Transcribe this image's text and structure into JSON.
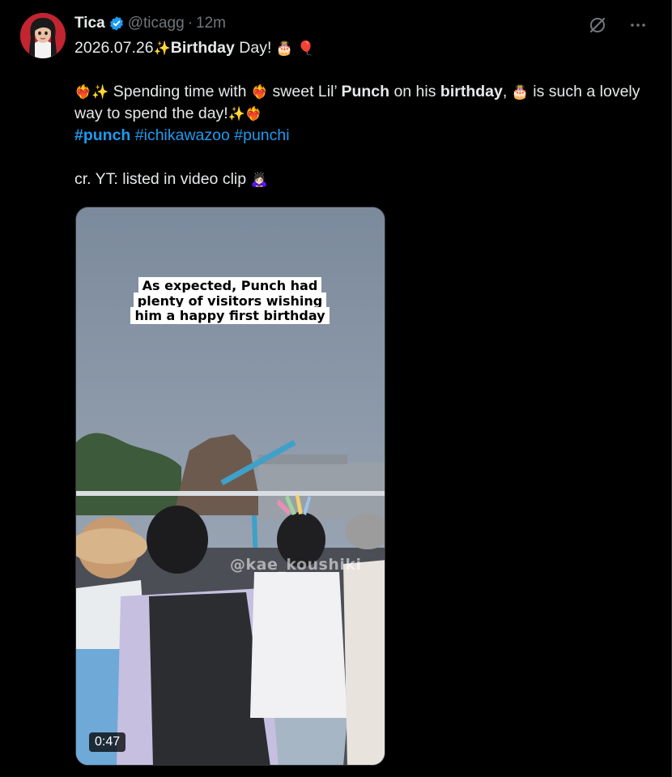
{
  "author": {
    "name": "Tica",
    "handle": "@ticagg",
    "separator": "·",
    "time": "12m"
  },
  "post": {
    "line1_date": "2026.07.26",
    "line1_bold": "Birthday",
    "line1_rest": " Day! ",
    "line2_a": " Spending time with ",
    "line2_b": " sweet Lil’ ",
    "line2_punch": "Punch",
    "line2_c": " on his ",
    "line2_birthday": "birthday",
    "line2_d": ", ",
    "line2_e": " is such a lovely way to spend the day!",
    "hashtags": [
      "#punch",
      "#ichikawazoo",
      "#punchi"
    ],
    "credit": "cr. YT: listed in video clip "
  },
  "emoji": {
    "sparkles": "✨",
    "cake": "🎂",
    "balloon": "🎈",
    "fire_heart": "❤️‍🔥",
    "bow": "🙇🏻‍♀️"
  },
  "video": {
    "caption_line1": "As expected, Punch had",
    "caption_line2": "plenty of visitors wishing",
    "caption_line3": "him a happy first birthday",
    "watermark": "@kae_koushiki",
    "duration": "0:47"
  },
  "icons": {
    "grok": "grok-icon",
    "more": "more-icon",
    "verified": "verified-badge-icon"
  },
  "colors": {
    "background": "#000000",
    "text": "#e7e9ea",
    "muted": "#71767b",
    "link": "#1d9bf0",
    "verified": "#1d9bf0"
  }
}
